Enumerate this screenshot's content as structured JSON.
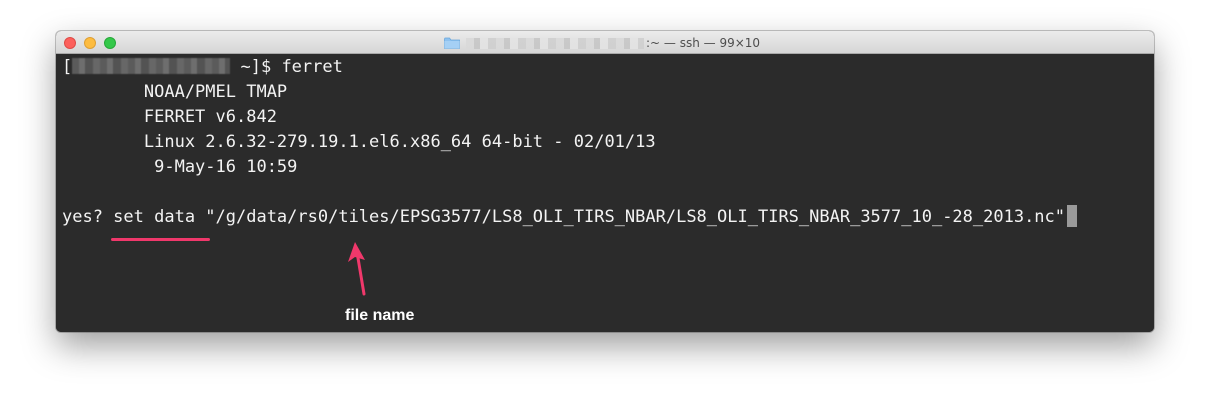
{
  "window": {
    "title_suffix": ":~ — ssh — 99×10",
    "controls": [
      "close-button",
      "minimize-button",
      "maximize-button"
    ]
  },
  "terminal": {
    "prompt_open": "[",
    "prompt_close": " ~]$ ",
    "prompt_command": "ferret",
    "banner": [
      "        NOAA/PMEL TMAP",
      "        FERRET v6.842",
      "        Linux 2.6.32-279.19.1.el6.x86_64 64-bit - 02/01/13",
      "         9-May-16 10:59"
    ],
    "input_line": "yes? set data \"/g/data/rs0/tiles/EPSG3577/LS8_OLI_TIRS_NBAR/LS8_OLI_TIRS_NBAR_3577_10_-28_2013.nc\""
  },
  "annotation": {
    "label": "file name",
    "color": "#f0386b"
  },
  "colors": {
    "terminal_bg": "#2b2b2b",
    "terminal_fg": "#f3f3f3",
    "accent": "#f0386b"
  }
}
